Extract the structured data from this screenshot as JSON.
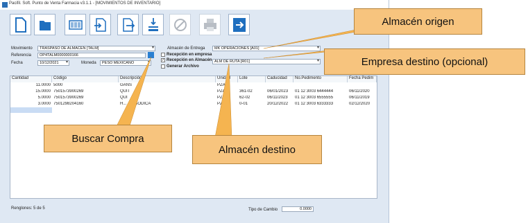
{
  "window": {
    "title": "Pacifil. Soft. Punto de Venta Farmacia v3.1.1 - [MOVIMIENTOS DE INVENTARIO]"
  },
  "toolbar": {
    "buttons": [
      {
        "icon": "new-document-icon"
      },
      {
        "icon": "folder-icon"
      },
      {
        "icon": "barcode-icon"
      },
      {
        "icon": "import-icon"
      },
      {
        "icon": "export-icon"
      },
      {
        "icon": "stack-icon"
      },
      {
        "icon": "cancel-icon"
      },
      {
        "icon": "printer-icon"
      },
      {
        "icon": "exit-icon"
      }
    ]
  },
  "form": {
    "movimiento_label": "Movimiento",
    "movimiento_value": "TRASPASO DE ALMACEN  [TALM]",
    "referencia_label": "Referencia",
    "referencia_value": "OP4TALM0000000166",
    "fecha_label": "Fecha",
    "fecha_value": "10/12/2021",
    "moneda_label": "Moneda",
    "moneda_value": "PESO MEXICANO",
    "almacen_entrega_label": "Almacén de Entrega",
    "almacen_entrega_value": "MK OPERACIONES  [A01]",
    "recepcion_empresa_label": "Recepción en empresa",
    "recepcion_almacen_label": "Recepción en Almacén",
    "recepcion_almacen_value": "ALM DE RUTA  [R01]",
    "generar_archivo_label": "Generar Archivo"
  },
  "table": {
    "headers": [
      "Cantidad",
      "Código",
      "Descripción",
      "Unidad",
      "Lote",
      "Caducidad",
      "No.Pedimento",
      "Fecha Pedim"
    ],
    "rows": [
      [
        "11.0000",
        "5000",
        "GANS",
        "PZA",
        "",
        "",
        "",
        ""
      ],
      [
        "15.0000",
        "7501573900269",
        "QUIT",
        "PZA",
        "361-02",
        "06/01/2023",
        "01 12 3003 6444444",
        "06/11/2020"
      ],
      [
        "5.0000",
        "7501573900269",
        "QUI",
        "PZA",
        "62-02",
        "06/11/2023",
        "01 12 3003 6555555",
        "06/11/2019"
      ],
      [
        "3.0000",
        "7501298204160",
        "H... ...A SODICA",
        "PZ",
        "0-01",
        "20/12/2022",
        "01 12 3003 6333333",
        "02/12/2020"
      ]
    ]
  },
  "footer": {
    "renglones": "Renglones: 5 de 5",
    "tipo_cambio_label": "Tipo de Cambio",
    "tipo_cambio_value": "0.0000"
  },
  "callouts": {
    "almacen_origen": "Almacén origen",
    "empresa_destino": "Empresa destino (opcional)",
    "buscar_compra": "Buscar Compra",
    "almacen_destino": "Almacén destino"
  },
  "colors": {
    "callout_fill": "#f7c47e",
    "toolbar_icon": "#1f6fbf",
    "arrow": "#f5b450"
  }
}
